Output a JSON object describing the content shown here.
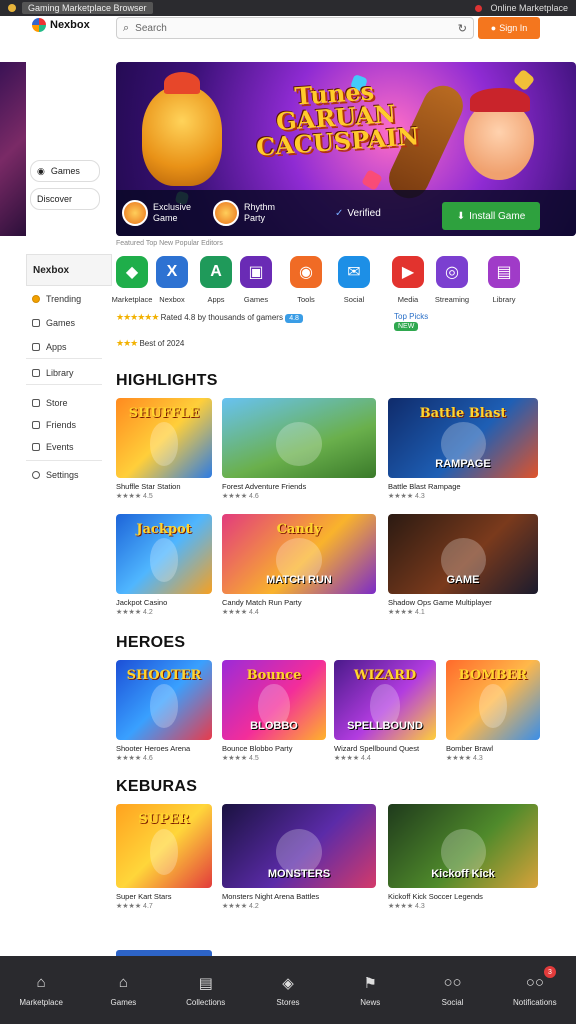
{
  "sysbar": {
    "title": "Gaming Marketplace Browser",
    "right_text": "Online Marketplace"
  },
  "header": {
    "logo": "Nexbox",
    "search_placeholder": "Search",
    "sign_button": "Sign In"
  },
  "sidebar": {
    "top_buttons": [
      "Games",
      "Discover"
    ],
    "heading": "Nexbox",
    "items": [
      "Trending",
      "Games",
      "Apps",
      "Library",
      "Store",
      "Friends",
      "Events",
      "Settings"
    ]
  },
  "hero": {
    "title_line1": "Tunes",
    "title_line2": "GARUAN",
    "title_line3": "CACUSPAIN",
    "tag1_line1": "Exclusive",
    "tag1_line2": "Game",
    "tag2_line1": "Rhythm",
    "tag2_line2": "Party",
    "verified": "Verified",
    "cta": "Install Game",
    "strip": "Featured   Top   New   Popular   Editors"
  },
  "apps": [
    {
      "label": "Marketplace",
      "color": "#1fae4a",
      "glyph": "◆"
    },
    {
      "label": "Nexbox",
      "color": "#2d72d2",
      "glyph": "X"
    },
    {
      "label": "Apps",
      "color": "#1f9a5a",
      "glyph": "A"
    },
    {
      "label": "Games",
      "color": "#6a2bb5",
      "glyph": "▣"
    },
    {
      "label": "Tools",
      "color": "#f06b25",
      "glyph": "◉"
    },
    {
      "label": "Social",
      "color": "#1d8fe6",
      "glyph": "✉"
    },
    {
      "label": "Media",
      "color": "#e2332e",
      "glyph": "▶"
    },
    {
      "label": "Streaming",
      "color": "#7b3fd0",
      "glyph": "◎"
    },
    {
      "label": "Library",
      "color": "#a03bc8",
      "glyph": "▤"
    }
  ],
  "ratings": {
    "line1": "Rated 4.8 by thousands of gamers",
    "line1_pill": "4.8",
    "line2": "Best of 2024",
    "right_label": "Top Picks",
    "right_pill": "NEW"
  },
  "sections": [
    {
      "title": "HIGHLIGHTS",
      "cards": [
        {
          "art": "SHUFFLE",
          "sub": "",
          "name": "Shuffle Star Station",
          "meta": "★★★★  4.5",
          "bg": "linear-gradient(135deg,#ff8a1f,#ffcf3a 50%,#2d7be3)"
        },
        {
          "art": "",
          "sub": "",
          "name": "Forest Adventure Friends",
          "meta": "★★★★  4.6",
          "bg": "linear-gradient(160deg,#68c2f2,#6ab04c 60%,#3a7a2a)"
        },
        {
          "art": "Battle Blast",
          "sub": "RAMPAGE",
          "name": "Battle Blast Rampage",
          "meta": "★★★★  4.3",
          "bg": "linear-gradient(135deg,#0f2b6b,#1e5fb5 55%,#e0532a)"
        },
        {
          "art": "Jackpot",
          "sub": "",
          "name": "Jackpot Casino",
          "meta": "★★★★  4.2",
          "bg": "linear-gradient(135deg,#1d64d8,#4fb6ff 50%,#f6a021)"
        },
        {
          "art": "Candy",
          "sub": "MATCH RUN",
          "name": "Candy Match Run Party",
          "meta": "★★★★  4.4",
          "bg": "linear-gradient(135deg,#e23b7d,#f9b32c 55%,#7b2bc8)"
        },
        {
          "art": "",
          "sub": "GAME",
          "name": "Shadow Ops Game Multiplayer",
          "meta": "★★★★  4.1",
          "bg": "linear-gradient(135deg,#2b1a12,#7a3a1c 55%,#1b1b2d)"
        }
      ]
    },
    {
      "title": "HEROES",
      "cards": [
        {
          "art": "SHOOTER",
          "sub": "",
          "name": "Shooter Heroes Arena",
          "meta": "★★★★  4.6",
          "bg": "linear-gradient(135deg,#1c4fd6,#39a0ff 50%,#e93a4a)"
        },
        {
          "art": "Bounce",
          "sub": "BLOBBO",
          "name": "Bounce Blobbo Party",
          "meta": "★★★★  4.5",
          "bg": "linear-gradient(135deg,#9b2bd8,#f32d9a 55%,#ffb32a)"
        },
        {
          "art": "WIZARD",
          "sub": "SPELLBOUND",
          "name": "Wizard Spellbound Quest",
          "meta": "★★★★  4.4",
          "bg": "linear-gradient(135deg,#4a1a8a,#b23ce0 55%,#ffcf3a)"
        },
        {
          "art": "BOMBER",
          "sub": "",
          "name": "Bomber Brawl",
          "meta": "★★★★  4.3",
          "bg": "linear-gradient(135deg,#ff6a2b,#ffb84a 50%,#3a8ee8)"
        }
      ]
    },
    {
      "title": "KEBURAS",
      "cards": [
        {
          "art": "SUPER",
          "sub": "",
          "name": "Super Kart Stars",
          "meta": "★★★★  4.7",
          "bg": "linear-gradient(135deg,#ffa21f,#ffd63a 50%,#e23b3b)"
        },
        {
          "art": "",
          "sub": "MONSTERS",
          "name": "Monsters Night Arena Battles",
          "meta": "★★★★  4.2",
          "bg": "linear-gradient(135deg,#1a1240,#5b2ba8 55%,#d43a6a)"
        },
        {
          "art": "",
          "sub": "Kickoff Kick",
          "name": "Kickoff Kick Soccer Legends",
          "meta": "★★★★  4.3",
          "bg": "linear-gradient(135deg,#1f3a1c,#4f8a2b 55%,#d8a23a)"
        }
      ]
    }
  ],
  "tabbar": [
    {
      "label": "Marketplace",
      "icon": "home-icon",
      "glyph": "⌂"
    },
    {
      "label": "Games",
      "icon": "games-icon",
      "glyph": "⌂"
    },
    {
      "label": "Collections",
      "icon": "collections-icon",
      "glyph": "▤"
    },
    {
      "label": "Stores",
      "icon": "store-icon",
      "glyph": "◈"
    },
    {
      "label": "News",
      "icon": "news-icon",
      "glyph": "⚑"
    },
    {
      "label": "Social",
      "icon": "social-icon",
      "glyph": "○○"
    },
    {
      "label": "Notifications",
      "icon": "notifications-icon",
      "glyph": "○○",
      "badge": "3"
    }
  ]
}
